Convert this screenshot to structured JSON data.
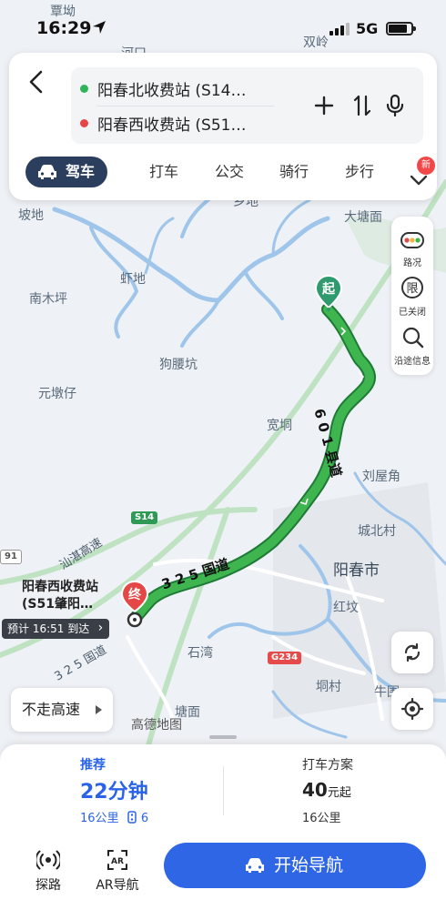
{
  "status_bar": {
    "time": "16:29",
    "network": "5G",
    "battery_level": 0.85
  },
  "route": {
    "origin": "阳春北收费站 (S14…",
    "destination": "阳春西收费站 (S51…",
    "origin_color": "#2fb45a",
    "destination_color": "#e54646"
  },
  "modes": {
    "items": [
      "驾车",
      "打车",
      "公交",
      "骑行",
      "步行"
    ],
    "active_index": 0,
    "new_badge": "新"
  },
  "tools": {
    "traffic": "路况",
    "restriction": "已关闭",
    "along_route": "沿途信息"
  },
  "map": {
    "start_marker": "起",
    "end_marker": "终",
    "place_labels": [
      "覃坳",
      "河口",
      "双岭",
      "坡地",
      "大塘面",
      "虾地",
      "南木坪",
      "狗腰坑",
      "元墩仔",
      "宽垌",
      "刘屋角",
      "城北村",
      "阳春市",
      "红坟",
      "石湾",
      "垌村",
      "牛围",
      "塘面",
      "乡地"
    ],
    "road_labels": [
      "汕湛高速",
      "3 2 5 国道",
      "3 2 5 国道",
      "6 0 1 县道"
    ],
    "road_badges": [
      "S14",
      "G234",
      "91"
    ],
    "watermark": "高德地图"
  },
  "destination_callout": {
    "name_line1": "阳春西收费站",
    "name_line2": "(S51肇阳…",
    "eta": "预计 16:51 到达"
  },
  "avoid_highway": "不走高速",
  "plans": {
    "recommended": {
      "tag": "推荐",
      "duration": "22分钟",
      "distance": "16公里",
      "lights": "6"
    },
    "taxi": {
      "tag": "打车方案",
      "price": "40",
      "price_unit": "元起",
      "distance": "16公里"
    }
  },
  "actions": {
    "explore": "探路",
    "ar_nav": "AR导航",
    "start_nav": "开始导航"
  }
}
